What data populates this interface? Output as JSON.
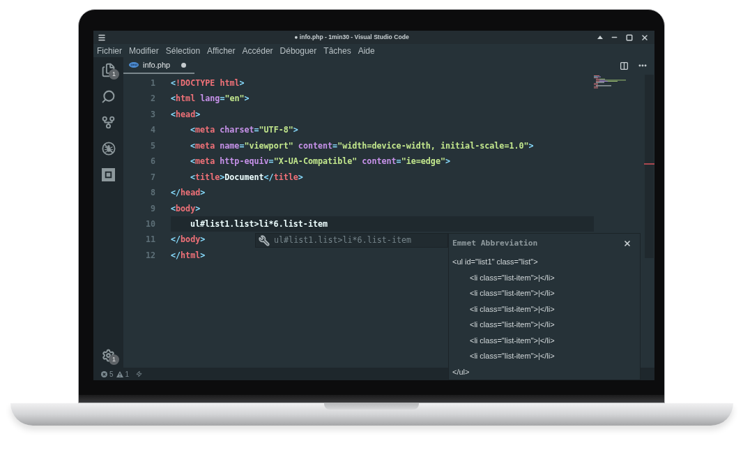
{
  "window": {
    "title": "● info.php - 1min30 - Visual Studio Code"
  },
  "menu": [
    "Fichier",
    "Modifier",
    "Sélection",
    "Afficher",
    "Accéder",
    "Déboguer",
    "Tâches",
    "Aide"
  ],
  "activity_bar": {
    "items": [
      {
        "kind": "files",
        "badge": "1"
      },
      {
        "kind": "search"
      },
      {
        "kind": "source_control"
      },
      {
        "kind": "debug"
      },
      {
        "kind": "extensions"
      }
    ],
    "settings": {
      "badge": "1"
    }
  },
  "tabs": [
    {
      "label": "info.php",
      "selected": true,
      "modified": true
    }
  ],
  "editor": {
    "lines": [
      {
        "number": "1",
        "current": false,
        "tokens": [
          {
            "kind": "punct",
            "text": "<"
          },
          {
            "kind": "tag",
            "text": "!DOCTYPE html"
          },
          {
            "kind": "punct",
            "text": ">"
          }
        ]
      },
      {
        "number": "2",
        "current": false,
        "tokens": [
          {
            "kind": "punct",
            "text": "<"
          },
          {
            "kind": "tag",
            "text": "html"
          },
          {
            "kind": "attr",
            "text": " lang"
          },
          {
            "kind": "punct",
            "text": "="
          },
          {
            "kind": "string",
            "text": "\"en\""
          },
          {
            "kind": "punct",
            "text": ">"
          }
        ]
      },
      {
        "number": "3",
        "current": false,
        "tokens": [
          {
            "kind": "punct",
            "text": "<"
          },
          {
            "kind": "tag",
            "text": "head"
          },
          {
            "kind": "punct",
            "text": ">"
          }
        ],
        "children": [
          {
            "number": "4",
            "current": false,
            "tokens": [
              {
                "kind": "punct",
                "text": "<"
              },
              {
                "kind": "tag",
                "text": "meta"
              },
              {
                "kind": "attr",
                "text": " charset"
              },
              {
                "kind": "punct",
                "text": "="
              },
              {
                "kind": "string",
                "text": "\"UTF-8\""
              },
              {
                "kind": "punct",
                "text": ">"
              }
            ]
          },
          {
            "number": "5",
            "current": false,
            "tokens": [
              {
                "kind": "punct",
                "text": "<"
              },
              {
                "kind": "tag",
                "text": "meta"
              },
              {
                "kind": "attr",
                "text": " name"
              },
              {
                "kind": "punct",
                "text": "="
              },
              {
                "kind": "string",
                "text": "\"viewport\""
              },
              {
                "kind": "attr",
                "text": " content"
              },
              {
                "kind": "punct",
                "text": "="
              },
              {
                "kind": "string",
                "text": "\"width=device-width, initial-scale=1.0\""
              },
              {
                "kind": "punct",
                "text": ">"
              }
            ]
          },
          {
            "number": "6",
            "current": false,
            "tokens": [
              {
                "kind": "punct",
                "text": "<"
              },
              {
                "kind": "tag",
                "text": "meta"
              },
              {
                "kind": "attr",
                "text": " http-equiv"
              },
              {
                "kind": "punct",
                "text": "="
              },
              {
                "kind": "string",
                "text": "\"X-UA-Compatible\""
              },
              {
                "kind": "attr",
                "text": " content"
              },
              {
                "kind": "punct",
                "text": "="
              },
              {
                "kind": "string",
                "text": "\"ie=edge\""
              },
              {
                "kind": "punct",
                "text": ">"
              }
            ]
          },
          {
            "number": "7",
            "current": false,
            "tokens": [
              {
                "kind": "punct",
                "text": "<"
              },
              {
                "kind": "tag",
                "text": "title"
              },
              {
                "kind": "punct",
                "text": ">"
              },
              {
                "kind": "text",
                "text": "Document"
              },
              {
                "kind": "punct",
                "text": "</"
              },
              {
                "kind": "tag",
                "text": "title"
              },
              {
                "kind": "punct",
                "text": ">"
              }
            ]
          }
        ]
      },
      {
        "number": "8",
        "current": false,
        "tokens": [
          {
            "kind": "punct",
            "text": "</"
          },
          {
            "kind": "tag",
            "text": "head"
          },
          {
            "kind": "punct",
            "text": ">"
          }
        ]
      },
      {
        "number": "9",
        "current": false,
        "tokens": [
          {
            "kind": "punct",
            "text": "<"
          },
          {
            "kind": "tag",
            "text": "body"
          },
          {
            "kind": "punct",
            "text": ">"
          }
        ],
        "children": [
          {
            "number": "10",
            "current": true,
            "tokens": [
              {
                "kind": "text",
                "text": "ul#list1.list>li*6.list-item"
              }
            ]
          }
        ]
      },
      {
        "number": "11",
        "current": false,
        "tokens": [
          {
            "kind": "punct",
            "text": "</"
          },
          {
            "kind": "tag",
            "text": "body"
          },
          {
            "kind": "punct",
            "text": ">"
          }
        ]
      },
      {
        "number": "12",
        "current": false,
        "tokens": [
          {
            "kind": "punct",
            "text": "</"
          },
          {
            "kind": "tag",
            "text": "html"
          },
          {
            "kind": "punct",
            "text": ">"
          }
        ]
      }
    ]
  },
  "suggestion": {
    "label": "ul#list1.list>li*6.list-item"
  },
  "emmet_panel": {
    "title": "Emmet Abbreviation",
    "lines": [
      {
        "text": "<ul id=\"list1\" class=\"list\">",
        "children": [
          {
            "text": "<li class=\"list-item\">|</li>"
          },
          {
            "text": "<li class=\"list-item\">|</li>"
          },
          {
            "text": "<li class=\"list-item\">|</li>"
          },
          {
            "text": "<li class=\"list-item\">|</li>"
          },
          {
            "text": "<li class=\"list-item\">|</li>"
          },
          {
            "text": "<li class=\"list-item\">|</li>"
          }
        ]
      },
      {
        "text": "</ul>"
      }
    ]
  },
  "status_bar": {
    "errors": "5",
    "warnings": "1"
  }
}
